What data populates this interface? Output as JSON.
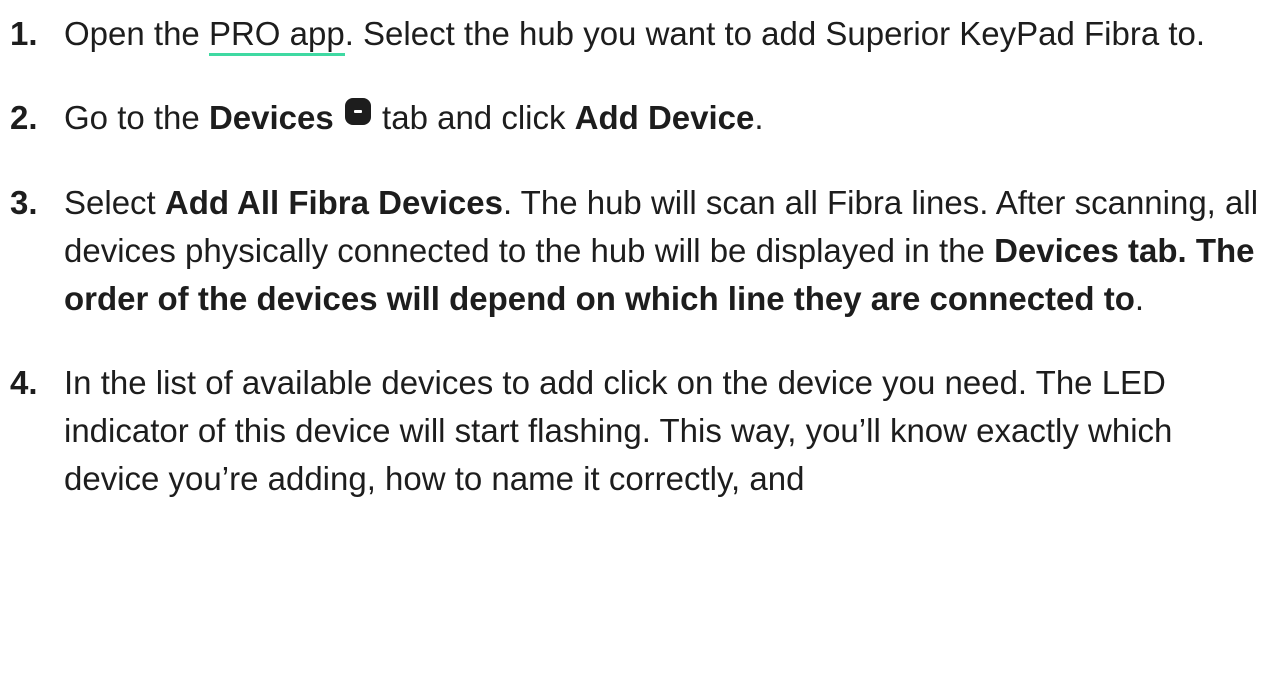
{
  "steps": [
    {
      "num": "1.",
      "pre": "Open the ",
      "link": "PRO app",
      "post": ". Select the hub you want to add Superior KeyPad Fibra to."
    },
    {
      "num": "2.",
      "pre": "Go to the ",
      "devices": "Devices",
      "mid": " tab and click ",
      "add_device": "Add Device",
      "post": "."
    },
    {
      "num": "3.",
      "pre": "Select ",
      "add_all": "Add All Fibra Devices",
      "mid1": ". The hub will scan all Fibra lines. After scanning, all devices physically connected to the hub will be displayed in the ",
      "bold_tail": "Devices tab. The order of the devices will depend on which line they are connected to",
      "post": "."
    },
    {
      "num": "4.",
      "text": "In the list of available devices to add click on the device you need. The LED indicator of this device will start flashing. This way, you’ll know exactly which device you’re adding, how to name it correctly, and"
    }
  ],
  "icons": {
    "devices_tab": "devices-tab-icon"
  },
  "colors": {
    "link_underline": "#3fd9a2",
    "text": "#1d1d1d"
  }
}
